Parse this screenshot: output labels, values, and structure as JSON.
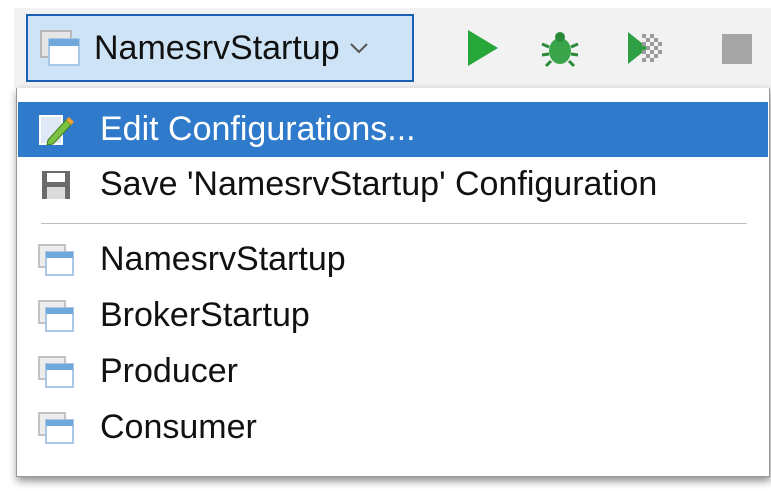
{
  "toolbar": {
    "config_name": "NamesrvStartup",
    "buttons": [
      {
        "name": "run-icon",
        "color": "#27a63a"
      },
      {
        "name": "debug-icon",
        "color": "#2ea043"
      },
      {
        "name": "coverage-icon",
        "color": "#2ea043"
      },
      {
        "name": "stop-icon",
        "color": "#9a9a9a"
      }
    ]
  },
  "menu": {
    "edit_label": "Edit Configurations...",
    "save_label": "Save 'NamesrvStartup' Configuration",
    "configs": [
      "NamesrvStartup",
      "BrokerStartup",
      "Producer",
      "Consumer"
    ],
    "selected_color": "#2f7acb"
  }
}
